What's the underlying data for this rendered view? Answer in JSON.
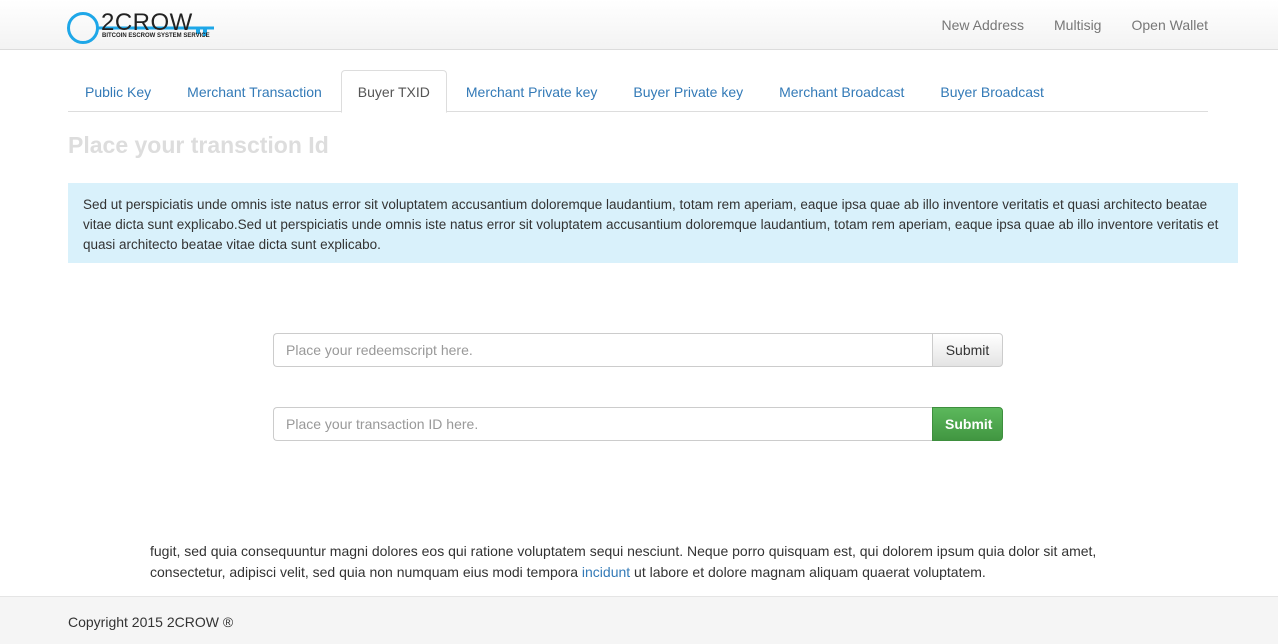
{
  "brand": {
    "name": "2CROW",
    "tagline": "BITCOIN ESCROW SYSTEM SERVICE",
    "accent_color": "#1ea7e8"
  },
  "nav": {
    "items": [
      "New Address",
      "Multisig",
      "Open Wallet"
    ]
  },
  "tabs": [
    {
      "label": "Public Key",
      "active": false
    },
    {
      "label": "Merchant Transaction",
      "active": false
    },
    {
      "label": "Buyer TXID",
      "active": true
    },
    {
      "label": "Merchant Private key",
      "active": false
    },
    {
      "label": "Buyer Private key",
      "active": false
    },
    {
      "label": "Merchant Broadcast",
      "active": false
    },
    {
      "label": "Buyer Broadcast",
      "active": false
    }
  ],
  "main": {
    "heading": "Place your transction Id",
    "info": "Sed ut perspiciatis unde omnis iste natus error sit voluptatem accusantium doloremque laudantium, totam rem aperiam, eaque ipsa quae ab illo inventore veritatis et quasi architecto beatae vitae dicta sunt explicabo.Sed ut perspiciatis unde omnis iste natus error sit voluptatem accusantium doloremque laudantium, totam rem aperiam, eaque ipsa quae ab illo inventore veritatis et quasi architecto beatae vitae dicta sunt explicabo.",
    "redeem": {
      "placeholder": "Place your redeemscript here.",
      "button": "Submit"
    },
    "txid": {
      "placeholder": "Place your transaction ID here.",
      "button": "Submit"
    },
    "bottom_text_before": "fugit, sed quia consequuntur magni dolores eos qui ratione voluptatem sequi nesciunt. Neque porro quisquam est, qui dolorem ipsum quia dolor sit amet, consectetur, adipisci velit, sed quia non numquam eius modi tempora ",
    "bottom_link": "incidunt",
    "bottom_text_after": " ut labore et dolore magnam aliquam quaerat voluptatem."
  },
  "footer": {
    "copyright": "Copyright 2015 2CROW ®"
  }
}
